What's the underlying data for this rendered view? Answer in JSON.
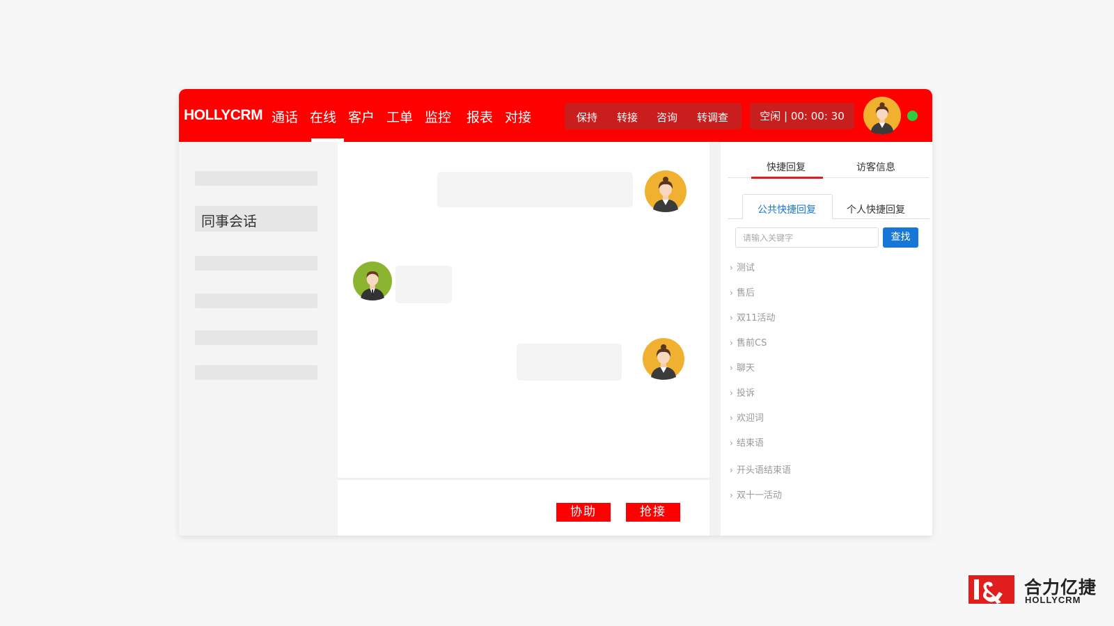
{
  "brand": "HOLLYCRM",
  "nav": {
    "items": [
      {
        "label": "通话"
      },
      {
        "label": "在线"
      },
      {
        "label": "客户"
      },
      {
        "label": "工单"
      },
      {
        "label": "监控"
      },
      {
        "label": "报表"
      },
      {
        "label": "对接"
      }
    ],
    "active": "在线"
  },
  "call_actions": [
    "保持",
    "转接",
    "咨询",
    "转调查"
  ],
  "status": {
    "text": "空闲 | 00:  00:  30",
    "online_color": "#2ecc40"
  },
  "left": {
    "colleague_label": "同事会话"
  },
  "chat": {
    "assist_button": "协助",
    "grab_button": "抢接"
  },
  "right": {
    "tabs": [
      "快捷回复",
      "访客信息"
    ],
    "subtabs": [
      "公共快捷回复",
      "个人快捷回复"
    ],
    "search_placeholder": "请输入关键字",
    "search_button": "查找",
    "quick_items": [
      "测试",
      "售后",
      "双11活动",
      "售前CS",
      "聊天",
      "投诉",
      "欢迎词",
      "结束语",
      "开头语结束语",
      "双十一活动"
    ]
  },
  "corp_logo": {
    "name_cn": "合力亿捷",
    "name_en": "HOLLYCRM"
  },
  "colors": {
    "accent": "#ff0000",
    "primary_blue": "#1677d6",
    "agent_avatar_bg": "#f0b030",
    "visitor_avatar_bg": "#8bb530"
  },
  "icons": [
    "agent-avatar-icon",
    "visitor-avatar-icon",
    "chevron-right-icon",
    "online-status-dot",
    "logo-mark-icon"
  ]
}
